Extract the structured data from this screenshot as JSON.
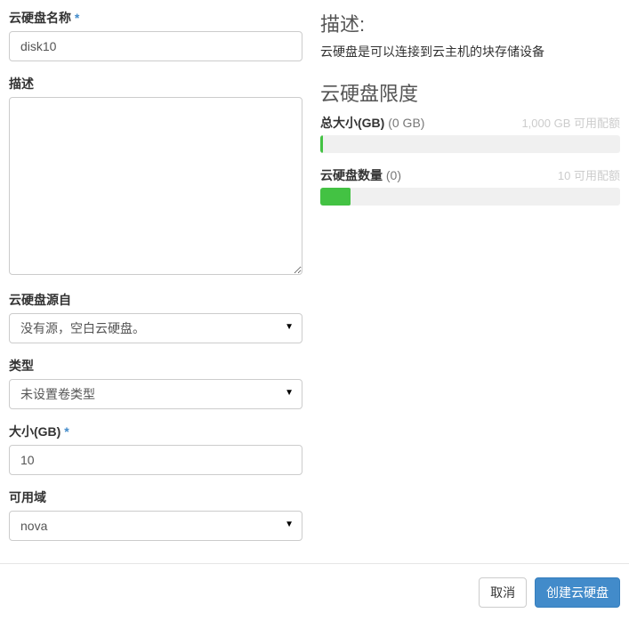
{
  "form": {
    "name": {
      "label": "云硬盘名称",
      "required": "*",
      "value": "disk10"
    },
    "desc": {
      "label": "描述",
      "value": ""
    },
    "source": {
      "label": "云硬盘源自",
      "selected": "没有源，空白云硬盘。"
    },
    "type": {
      "label": "类型",
      "selected": "未设置卷类型"
    },
    "size": {
      "label": "大小(GB)",
      "required": "*",
      "value": "10"
    },
    "az": {
      "label": "可用域",
      "selected": "nova"
    }
  },
  "right": {
    "desc_title": "描述:",
    "desc_text": "云硬盘是可以连接到云主机的块存储设备",
    "limits_title": "云硬盘限度",
    "quotas": [
      {
        "name": "总大小(GB)",
        "current": "(0 GB)",
        "avail": "1,000 GB 可用配额",
        "pct": 1
      },
      {
        "name": "云硬盘数量",
        "current": "(0)",
        "avail": "10 可用配额",
        "pct": 10
      }
    ]
  },
  "footer": {
    "cancel": "取消",
    "submit": "创建云硬盘"
  }
}
